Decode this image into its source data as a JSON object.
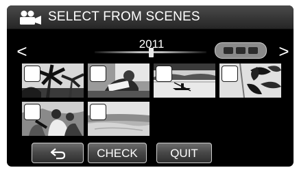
{
  "header": {
    "title": "SELECT FROM SCENES",
    "mode_icon": "video-camera-icon"
  },
  "navigation": {
    "prev_label": "<",
    "next_label": ">",
    "year": "2011",
    "page_indicator_dots": 3
  },
  "thumbnails": [
    {
      "scene": "palm-trees",
      "checked": false
    },
    {
      "scene": "person-reading",
      "checked": false
    },
    {
      "scene": "kayak-on-lake",
      "checked": false
    },
    {
      "scene": "leaves-closeup",
      "checked": false
    },
    {
      "scene": "family-playing",
      "checked": false
    },
    {
      "scene": "beach-shore",
      "checked": false
    }
  ],
  "buttons": {
    "back_icon": "return-arrow-icon",
    "check_label": "CHECK",
    "quit_label": "QUIT"
  },
  "colors": {
    "background": "#000000",
    "title_bar": "#3a3a3a",
    "text": "#ffffff"
  }
}
